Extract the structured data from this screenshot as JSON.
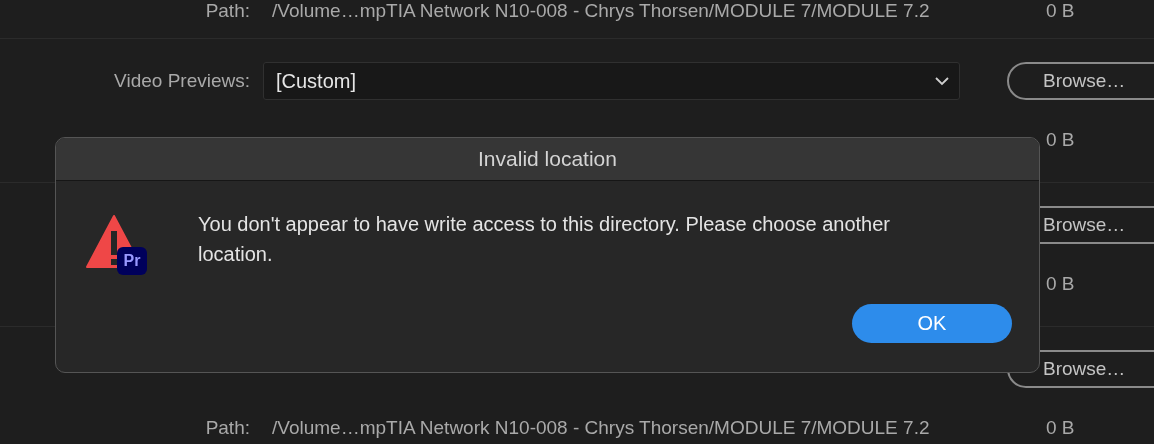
{
  "settings_rows": [
    {
      "kind": "path",
      "label": "Path:",
      "value": "/Volume…mpTIA Network N10-008 - Chrys Thorsen/MODULE 7/MODULE 7.2",
      "size": "0 B"
    },
    {
      "kind": "location",
      "label": "Video Previews:",
      "value": "[Custom]",
      "button": "Browse…"
    },
    {
      "kind": "path",
      "size": "0 B"
    },
    {
      "kind": "location",
      "button": "Browse…"
    },
    {
      "kind": "path",
      "size": "0 B"
    },
    {
      "kind": "location",
      "button": "Browse…"
    },
    {
      "kind": "path",
      "label": "Path:",
      "value": "/Volume…mpTIA Network N10-008 - Chrys Thorsen/MODULE 7/MODULE 7.2",
      "size": "0 B"
    }
  ],
  "dialog": {
    "title": "Invalid location",
    "app_badge": "Pr",
    "message": "You don't appear to have write access to this directory. Please choose another location.",
    "buttons": [
      {
        "label": "OK",
        "default": true
      }
    ]
  }
}
